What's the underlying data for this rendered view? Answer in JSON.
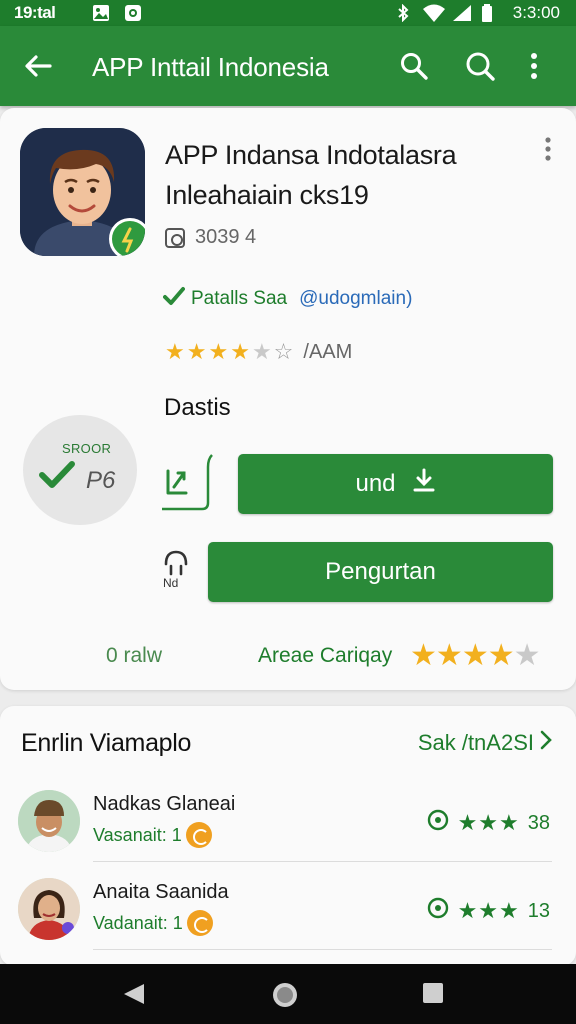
{
  "status_bar": {
    "time": "19:tal",
    "clock": "3:3:00"
  },
  "app_bar": {
    "title": "APP Inttail Indonesia"
  },
  "app": {
    "title_line1": "APP Indansa Indotalasra",
    "title_line2": "Inleahaiain cks19",
    "meta": "3039 4",
    "developer": "Patalls Saa",
    "developer_handle": "@udogmlain)",
    "rating_tag": "/AAM",
    "section_label": "Dastis"
  },
  "score": {
    "label": "SROOR",
    "value": "P6"
  },
  "buttons": {
    "install_label": "und",
    "secondary_label": "Pengurtan"
  },
  "side": {
    "icon2_label": "Nd"
  },
  "bottom_row": {
    "left_text": "0 ralw",
    "right_text": "Areae Cariqay"
  },
  "reviews": {
    "heading": "Enrlin Viamaplo",
    "see_all": "Sak /tnA2SI",
    "items": [
      {
        "name": "Nadkas Glaneai",
        "sub": "Vasanait: 1",
        "count": "38"
      },
      {
        "name": "Anaita Saanida",
        "sub": "Vadanait: 1",
        "count": "13"
      }
    ]
  },
  "colors": {
    "primary": "#2a8a39",
    "primary_dark": "#1e7d2c",
    "star": "#f2b01e"
  }
}
